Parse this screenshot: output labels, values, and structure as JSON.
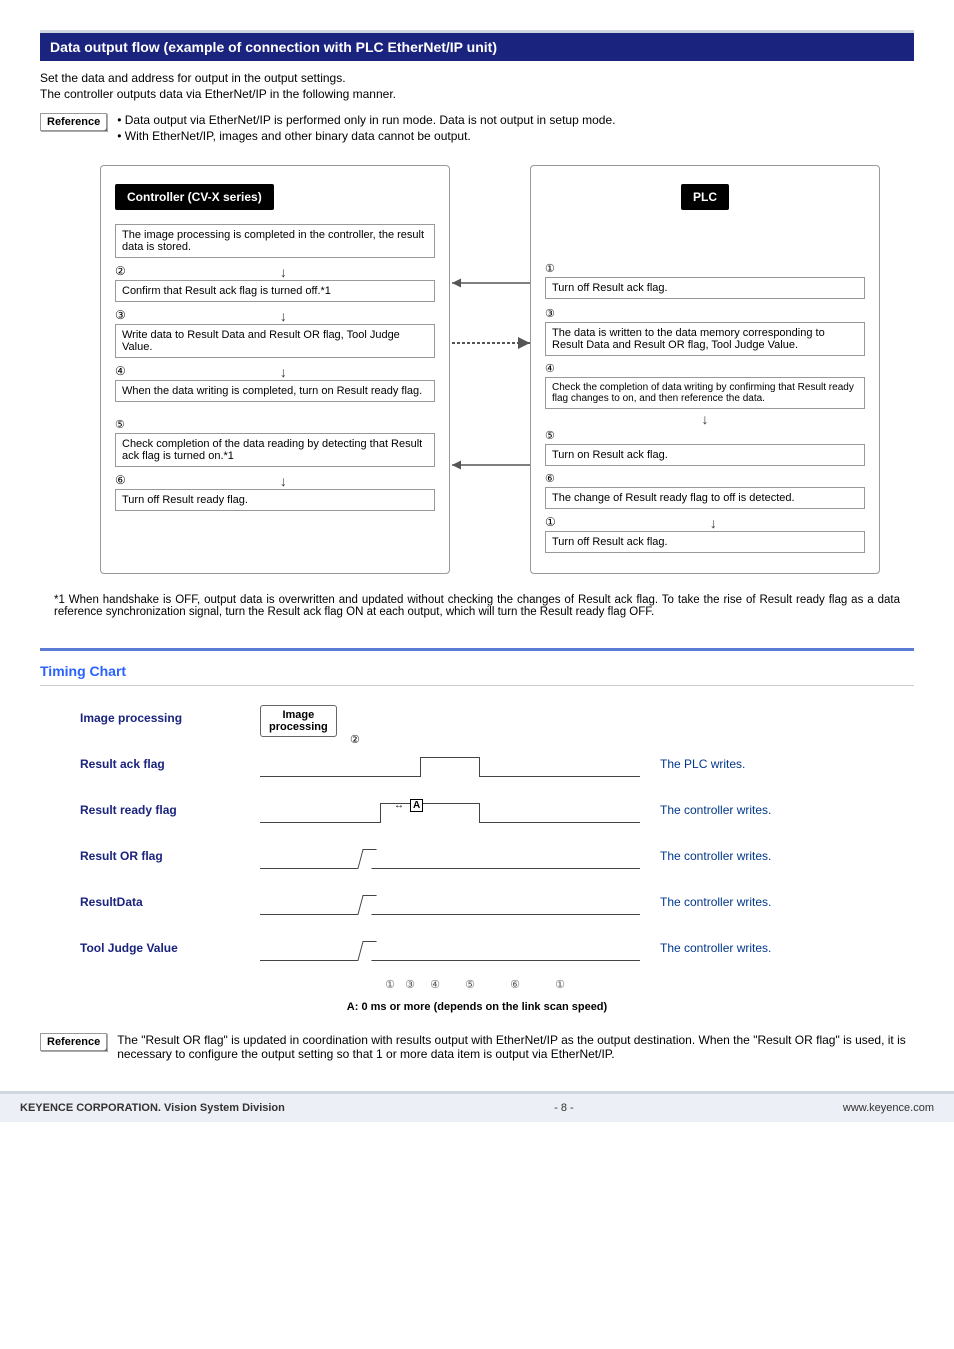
{
  "section_title": "Data output flow (example of connection with PLC EtherNet/IP unit)",
  "intro": {
    "line1": "Set the data and address for output in the output settings.",
    "line2": "The controller outputs data via EtherNet/IP in the following manner."
  },
  "reference1": {
    "label": "Reference",
    "items": [
      "Data output via EtherNet/IP is performed only in run mode. Data is not output in setup mode.",
      "With EtherNet/IP, images and other binary data cannot be output."
    ]
  },
  "diagram": {
    "left": {
      "title": "Controller (CV-X series)",
      "top_desc": "The image processing is completed in the controller, the result data is stored.",
      "steps": [
        {
          "num": "②",
          "box": "Confirm that Result ack flag is turned off.*1"
        },
        {
          "num": "③",
          "box": "Write data to Result Data and Result OR flag, Tool Judge Value."
        },
        {
          "num": "④",
          "box": "When the data writing is completed, turn on Result ready flag."
        },
        {
          "num": "⑤",
          "box": "Check completion of the data reading by detecting that Result ack flag is turned on.*1"
        },
        {
          "num": "⑥",
          "box": "Turn off Result ready flag."
        }
      ]
    },
    "right": {
      "title": "PLC",
      "steps": [
        {
          "num": "①",
          "box": "Turn off Result ack flag."
        },
        {
          "num": "③",
          "desc": "The data is written to the data memory corresponding to Result Data and Result OR flag, Tool Judge Value."
        },
        {
          "num": "④",
          "desc": "Check the completion of data writing by confirming that Result ready flag changes to on, and then reference the data."
        },
        {
          "num": "⑤",
          "box": "Turn on Result ack flag."
        },
        {
          "num": "⑥",
          "desc": "The change of Result ready flag to off is detected."
        },
        {
          "num": "①",
          "box": "Turn off Result ack flag."
        }
      ]
    }
  },
  "footnote": "*1 When handshake is OFF, output data is overwritten and updated without checking the changes of Result ack flag. To take the rise of Result ready flag as a data reference synchronization signal, turn the Result ack flag ON at each output, which will turn the Result ready flag OFF.",
  "timing": {
    "header": "Timing Chart",
    "rows": [
      {
        "label": "Image processing",
        "note": "",
        "proc": "Image\nprocessing"
      },
      {
        "label": "Result ack flag",
        "note": "The PLC writes."
      },
      {
        "label": "Result ready flag",
        "note": "The controller writes.",
        "marker": "A"
      },
      {
        "label": "Result OR flag",
        "note": "The controller writes."
      },
      {
        "label": "ResultData",
        "note": "The controller writes."
      },
      {
        "label": "Tool Judge Value",
        "note": "The controller writes."
      }
    ],
    "axis": [
      "①",
      "③",
      "④",
      "⑤",
      "⑥",
      "①"
    ],
    "axis_extra": "②",
    "caption": "A: 0 ms or more (depends on the link scan speed)"
  },
  "reference2": {
    "label": "Reference",
    "text": "The \"Result OR flag\" is updated in coordination with results output with EtherNet/IP as the output destination. When the \"Result OR flag\" is used, it is necessary to configure the output setting so that 1 or more data item is output via EtherNet/IP."
  },
  "footer": {
    "left": "KEYENCE CORPORATION. Vision System Division",
    "center": "- 8 -",
    "right": "www.keyence.com"
  }
}
